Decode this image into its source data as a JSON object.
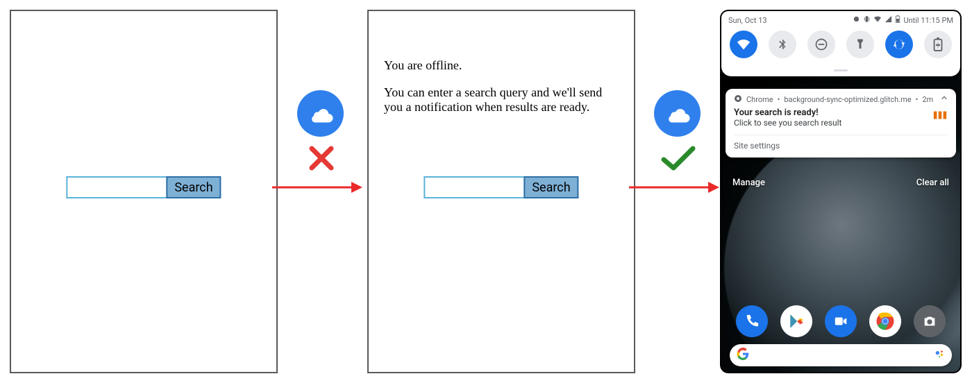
{
  "panel1": {
    "search_button_label": "Search",
    "search_value": ""
  },
  "transition1": {
    "cloud_name": "offline-cloud-icon",
    "status": "cross"
  },
  "panel2": {
    "offline_heading": "You are offline.",
    "offline_body": "You can enter a search query and we'll send you a notification when results are ready.",
    "search_button_label": "Search",
    "search_value": ""
  },
  "transition2": {
    "cloud_name": "online-cloud-icon",
    "status": "check"
  },
  "phone": {
    "status_bar": {
      "date": "Sun, Oct 13",
      "right_label": "Until 11:15 PM"
    },
    "quick_settings": [
      {
        "name": "wifi",
        "on": true
      },
      {
        "name": "bluetooth",
        "on": false
      },
      {
        "name": "dnd",
        "on": false
      },
      {
        "name": "flashlight",
        "on": false
      },
      {
        "name": "autorotate",
        "on": true
      },
      {
        "name": "battery-saver",
        "on": false
      }
    ],
    "notification": {
      "app_label": "Chrome",
      "source": "background-sync-optimized.glitch.me",
      "age": "2m",
      "title": "Your search is ready!",
      "body": "Click to see you search result",
      "action": "Site settings"
    },
    "shade_controls": {
      "manage": "Manage",
      "clear": "Clear all"
    },
    "dock": [
      "phone",
      "play",
      "duo",
      "chrome",
      "camera"
    ]
  }
}
